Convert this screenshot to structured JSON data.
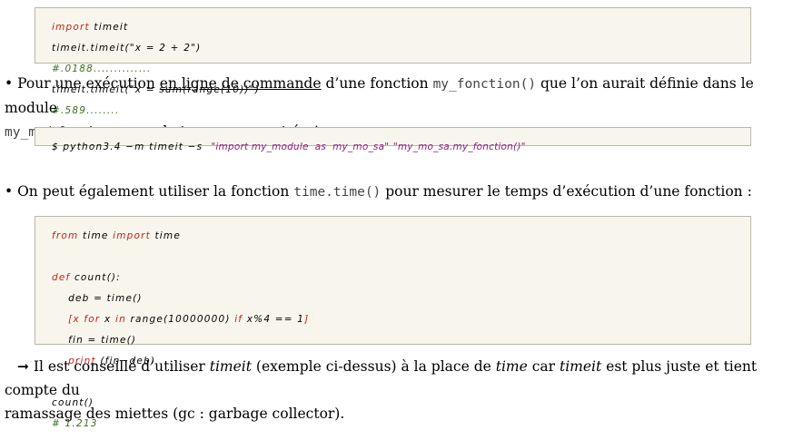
{
  "code1": {
    "lines": [
      {
        "k1": "import",
        "t1": " timeit"
      },
      {
        "t1": "timeit.timeit(\"x = 2 + 2\")"
      },
      {
        "c1": "#.0188.............."
      },
      {
        "t1": "timeit.timeit(\"x = sum(range(10))\")"
      },
      {
        "c1": "#.589........"
      }
    ]
  },
  "para1": {
    "bullet": "•",
    "a": " Pour une exécution ",
    "link": "en ligne de commande",
    "b": " d’une fonction ",
    "code_a": "my_fonction()",
    "c": " que l’on aurait définie dans le module",
    "code_b": "my_module",
    "d": " et mesurer le temps, on peut écrire :"
  },
  "code2": {
    "cmd": "$ python3.4 −m timeit −s  ",
    "arg1": "\"import my_module  as  my_mo_sa\"",
    "sep": " ",
    "arg2": "\"my_mo_sa.my_fonction()\""
  },
  "para2": {
    "bullet": "•",
    "a": " On peut également utiliser la fonction ",
    "code": "time.time()",
    "b": " pour mesurer le temps d’exécution d’une fonction :"
  },
  "code3": {
    "l1_k": "from",
    "l1_t": " time ",
    "l1_k2": "import",
    "l1_t2": " time",
    "l3_k": "def",
    "l3_t": " count():",
    "l4": "    deb = time()",
    "l5_a": "    [x ",
    "l5_for": "for",
    "l5_b": " x ",
    "l5_in": "in",
    "l5_c": " range(10000000) ",
    "l5_if": "if",
    "l5_d": " x%4 == 1",
    "l5_e": "]",
    "l6": "    fin = time()",
    "l7_a": "    ",
    "l7_k": "print",
    "l7_b": " (fin−deb)",
    "l9": "count()",
    "l10": "# 1.213"
  },
  "para3": {
    "arrow": "➞",
    "a": " Il est conseillé d’utiliser ",
    "em1": "timeit",
    "b": " (exemple ci-dessus) à la place de ",
    "em2": "time",
    "c": " car ",
    "em3": "timeit",
    "d": " est plus juste et tient compte du",
    "e": "ramassage des miettes (gc : garbage collector)."
  }
}
